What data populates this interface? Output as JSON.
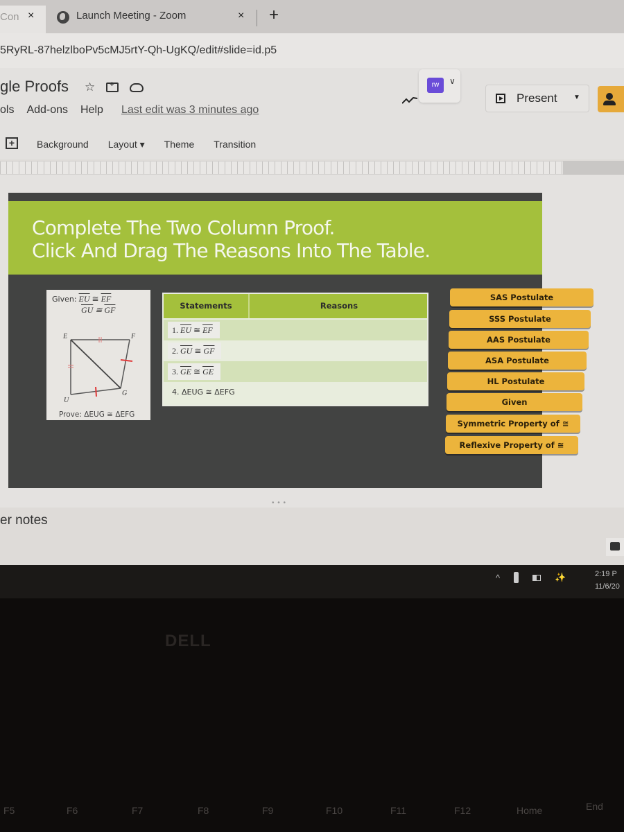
{
  "browser": {
    "tabs": [
      {
        "label": "Con",
        "active": false
      },
      {
        "label": "Launch Meeting - Zoom",
        "active": true
      }
    ],
    "close_glyph": "×",
    "new_tab_glyph": "+",
    "url": "5RyRL-87helzlboPv5cMJ5rtY-Qh-UgKQ/edit#slide=id.p5"
  },
  "document": {
    "title": "gle Proofs",
    "star_glyph": "☆",
    "menus": [
      "ols",
      "Add-ons",
      "Help"
    ],
    "last_edit": "Last edit was 3 minutes ago",
    "addon_label": "rw",
    "present_label": "Present"
  },
  "toolbar": {
    "items": [
      "Background",
      "Layout ▾",
      "Theme",
      "Transition"
    ]
  },
  "slide": {
    "heading_line1": "Complete The Two Column Proof.",
    "heading_line2": "Click And Drag The Reasons Into The Table.",
    "given_label": "Given:",
    "given_1_a": "EU",
    "given_1_b": "EF",
    "given_2_a": "GU",
    "given_2_b": "GF",
    "congruent": "≅",
    "diagram_points": {
      "E": "E",
      "F": "F",
      "G": "G",
      "U": "U"
    },
    "prove": "Prove: ΔEUG ≅ ΔEFG",
    "table": {
      "headers": [
        "Statements",
        "Reasons"
      ],
      "rows": [
        {
          "num": "1.",
          "a": "EU",
          "b": "EF",
          "reason": ""
        },
        {
          "num": "2.",
          "a": "GU",
          "b": "GF",
          "reason": ""
        },
        {
          "num": "3.",
          "a": "GE",
          "b": "GE",
          "reason": ""
        },
        {
          "num": "4.",
          "text": "ΔEUG ≅ ΔEFG",
          "reason": ""
        }
      ]
    },
    "reason_options": [
      "SAS Postulate",
      "SSS Postulate",
      "AAS Postulate",
      "ASA Postulate",
      "HL Postulate",
      "Given",
      "Symmetric Property of ≅",
      "Reflexive Property of ≅"
    ],
    "accent_green": "#a4c03c",
    "tile_color": "#ecb43c"
  },
  "notes_label": "er notes",
  "slide_dots": "• • •",
  "taskbar": {
    "time": "2:19 P",
    "date": "11/6/20",
    "tray_caret": "^"
  },
  "laptop": {
    "brand": "DELL",
    "keys": [
      "F5",
      "F6",
      "F7",
      "F8",
      "F9",
      "F10",
      "F11",
      "F12",
      "Home",
      "End"
    ]
  }
}
